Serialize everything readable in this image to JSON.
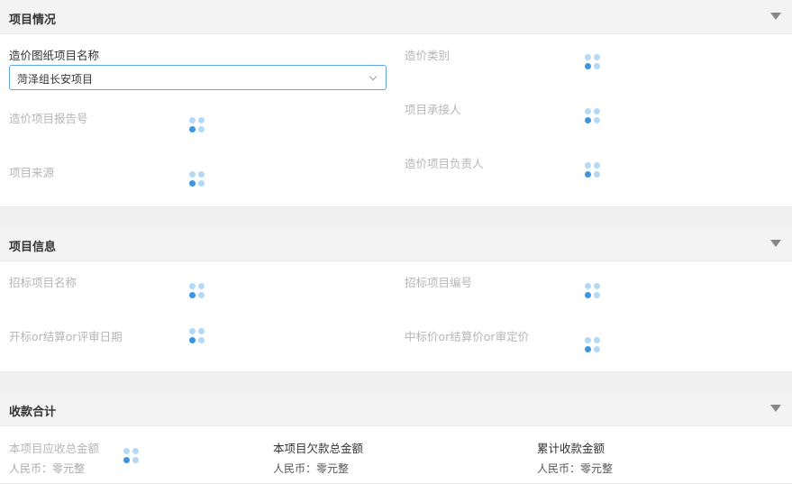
{
  "project_status": {
    "title": "项目情况",
    "drawing_project_label": "造价图纸项目名称",
    "drawing_project_value": "菏泽组长安项目",
    "cost_category_label": "造价类别",
    "report_number_label": "造价项目报告号",
    "undertaker_label": "项目承接人",
    "source_label": "项目来源",
    "manager_label": "造价项目负责人"
  },
  "project_info": {
    "title": "项目信息",
    "bid_name_label": "招标项目名称",
    "bid_number_label": "招标项目编号",
    "date_label": "开标or结算or评审日期",
    "price_label": "中标价or结算价or审定价"
  },
  "collection": {
    "title": "收款合计",
    "receivable_label": "本项目应收总金额",
    "receivable_value": "人民币：零元整",
    "owed_label": "本项目欠款总金额",
    "owed_value": "人民币：零元整",
    "collected_label": "累计收款金额",
    "collected_value": "人民币：零元整"
  },
  "colors": {
    "accent": "#5ea6e6",
    "spinner_dark": "#3d95e0",
    "spinner_light": "#b3d9f5"
  }
}
